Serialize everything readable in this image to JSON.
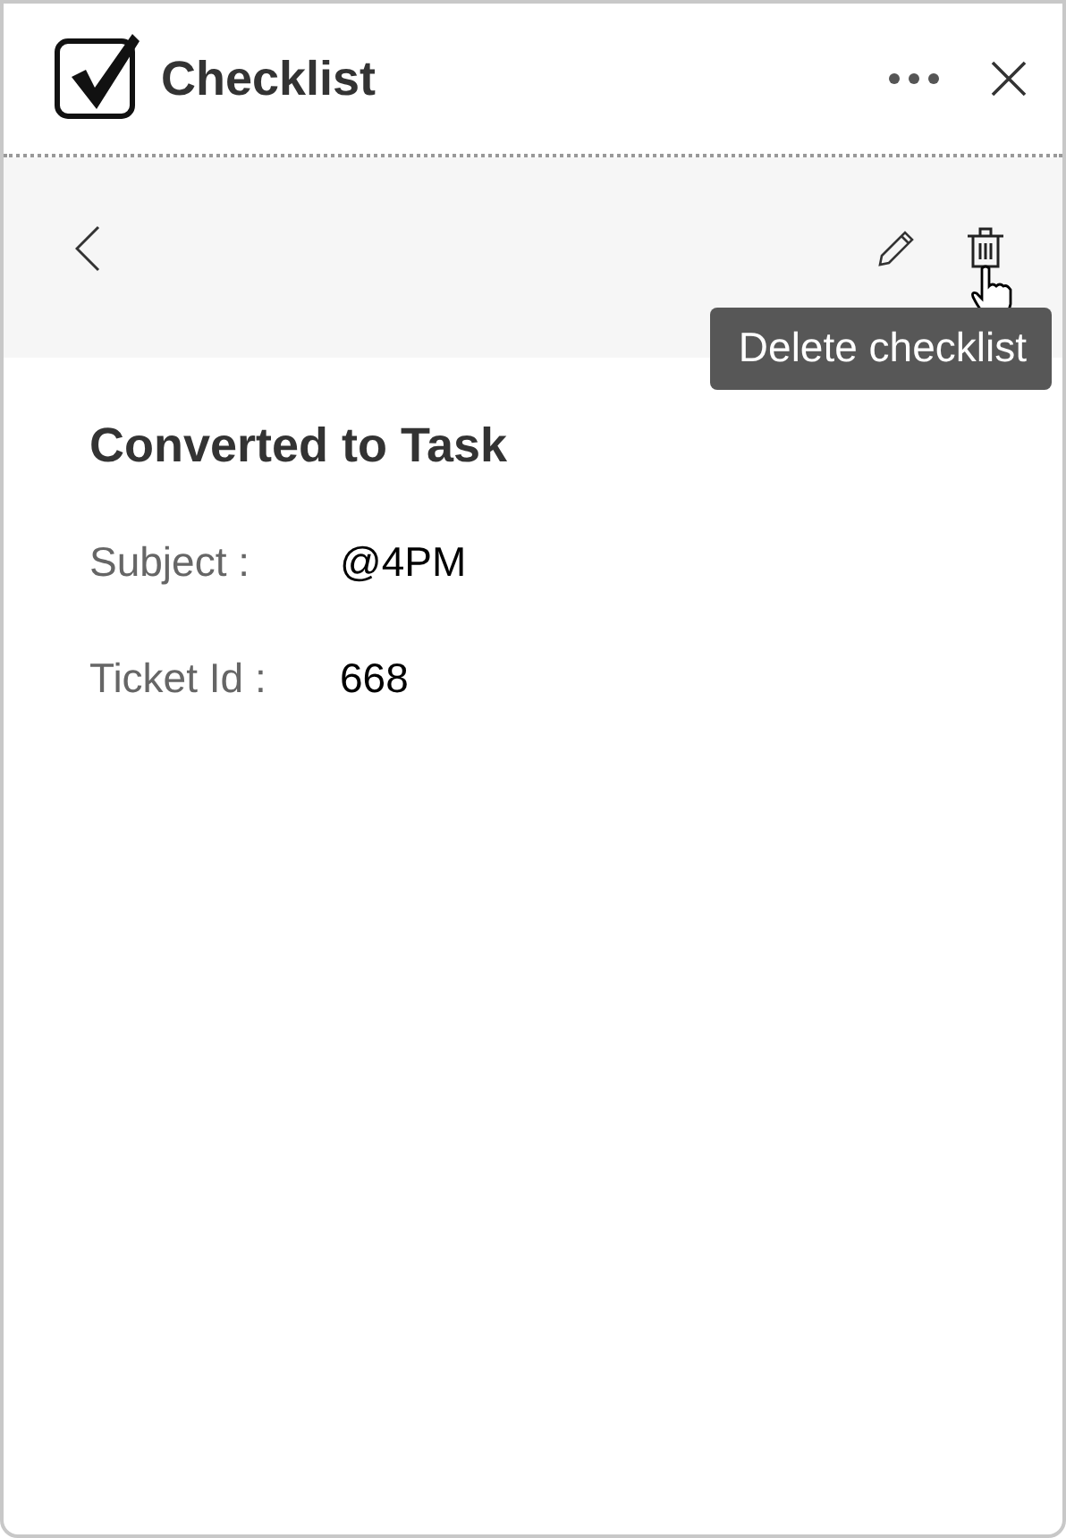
{
  "header": {
    "title": "Checklist"
  },
  "toolbar": {
    "tooltip": "Delete checklist"
  },
  "heading": "Converted to Task",
  "fields": [
    {
      "label": "Subject :",
      "value": "@4PM"
    },
    {
      "label": "Ticket Id :",
      "value": "668"
    }
  ]
}
